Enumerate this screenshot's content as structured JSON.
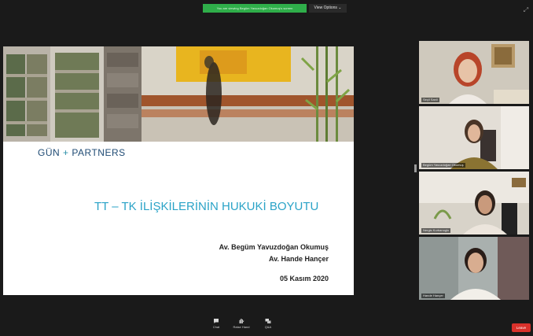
{
  "banner": {
    "share_text": "You are viewing Begüm Yavuzdoğan Okumuş's screen",
    "view_options": "View Options ⌄"
  },
  "slide": {
    "logo_left": "GÜN",
    "logo_plus": "+",
    "logo_right": "PARTNERS",
    "title": "TT – TK İLİŞKİLERİNİN HUKUKİ BOYUTU",
    "author1": "Av. Begüm Yavuzdoğan Okumuş",
    "author2": "Av. Hande Hançer",
    "date": "05 Kasım 2020"
  },
  "participants": [
    {
      "name": "Seçil Sanli"
    },
    {
      "name": "Begüm Yavuzdoğan Okumuş"
    },
    {
      "name": "Nergis Kurbanoglu"
    },
    {
      "name": "Hande Hançer"
    }
  ],
  "toolbar": {
    "chat": "Chat",
    "raise_hand": "Raise Hand",
    "qa": "Q&A",
    "leave": "Leave"
  },
  "colors": {
    "share_banner": "#2fae4a",
    "slide_title": "#2aa3c7",
    "logo": "#1f4b74",
    "leave": "#d9312b"
  }
}
